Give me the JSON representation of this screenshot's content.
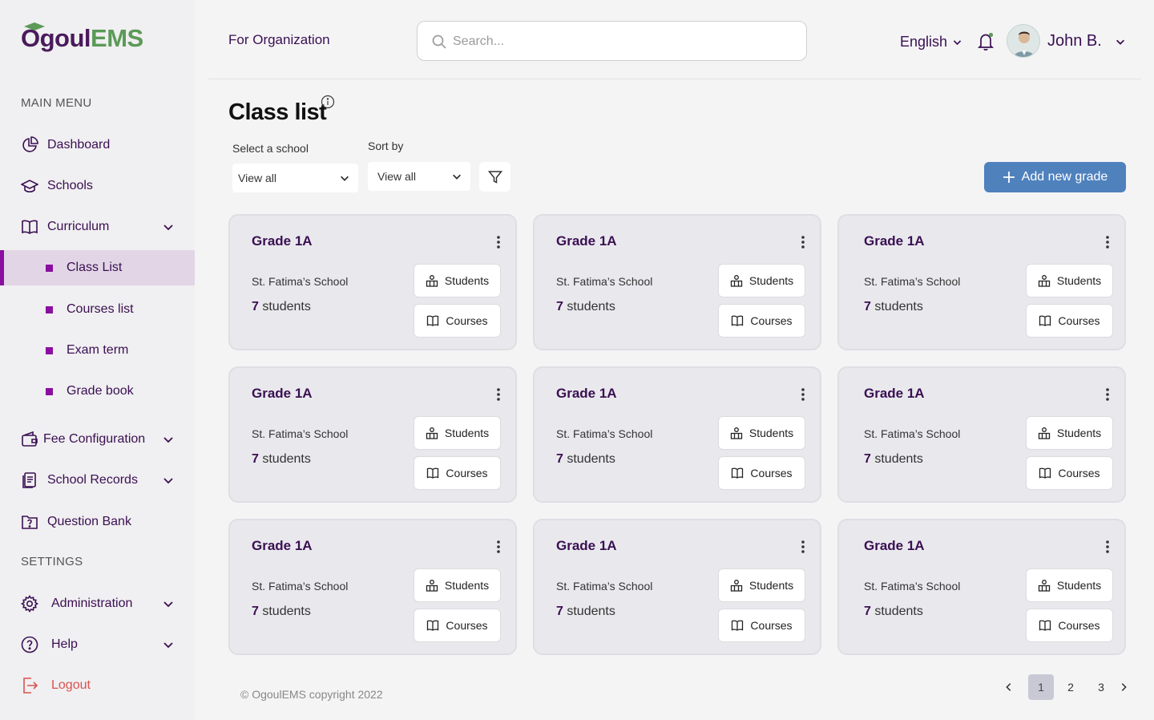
{
  "brand": {
    "part1": "Ogoul",
    "part2": "EMS"
  },
  "sidebar": {
    "main_menu_label": "MAIN MENU",
    "settings_label": "SETTINGS",
    "items": {
      "dashboard": "Dashboard",
      "schools": "Schools",
      "curriculum": "Curriculum",
      "class_list": "Class List",
      "courses_list": "Courses list",
      "exam_term": "Exam term",
      "grade_book": "Grade book",
      "fee_configuration": "Fee Configuration",
      "school_records": "School Records",
      "question_bank": "Question Bank",
      "administration": "Administration",
      "help": "Help",
      "logout": "Logout"
    }
  },
  "topbar": {
    "title": "For Organization",
    "search_placeholder": "Search...",
    "language": "English",
    "username": "John B."
  },
  "page": {
    "title": "Class list",
    "select_school_label": "Select a school",
    "select_school_value": "View all",
    "sort_by_label": "Sort by",
    "sort_by_value": "View all",
    "add_button": "Add new grade"
  },
  "cards": [
    {
      "grade": "Grade 1A",
      "school": "St. Fatima’s School",
      "count": "7",
      "count_suffix": "students",
      "students_btn": "Students",
      "courses_btn": "Courses"
    },
    {
      "grade": "Grade 1A",
      "school": "St. Fatima’s School",
      "count": "7",
      "count_suffix": "students",
      "students_btn": "Students",
      "courses_btn": "Courses"
    },
    {
      "grade": "Grade 1A",
      "school": "St. Fatima’s School",
      "count": "7",
      "count_suffix": "students",
      "students_btn": "Students",
      "courses_btn": "Courses"
    },
    {
      "grade": "Grade 1A",
      "school": "St. Fatima’s School",
      "count": "7",
      "count_suffix": "students",
      "students_btn": "Students",
      "courses_btn": "Courses"
    },
    {
      "grade": "Grade 1A",
      "school": "St. Fatima’s School",
      "count": "7",
      "count_suffix": "students",
      "students_btn": "Students",
      "courses_btn": "Courses"
    },
    {
      "grade": "Grade 1A",
      "school": "St. Fatima’s School",
      "count": "7",
      "count_suffix": "students",
      "students_btn": "Students",
      "courses_btn": "Courses"
    },
    {
      "grade": "Grade 1A",
      "school": "St. Fatima’s School",
      "count": "7",
      "count_suffix": "students",
      "students_btn": "Students",
      "courses_btn": "Courses"
    },
    {
      "grade": "Grade 1A",
      "school": "St. Fatima’s School",
      "count": "7",
      "count_suffix": "students",
      "students_btn": "Students",
      "courses_btn": "Courses"
    },
    {
      "grade": "Grade 1A",
      "school": "St. Fatima’s School",
      "count": "7",
      "count_suffix": "students",
      "students_btn": "Students",
      "courses_btn": "Courses"
    }
  ],
  "footer": {
    "copyright": "© OgoulEMS copyright 2022",
    "pages": [
      "1",
      "2",
      "3"
    ],
    "current_page": "1"
  },
  "colors": {
    "brand_purple": "#3a0f52",
    "accent_magenta": "#8a0fa0",
    "brand_green": "#5b9a57",
    "primary_button": "#4f81bd",
    "logout_red": "#d9534f"
  }
}
